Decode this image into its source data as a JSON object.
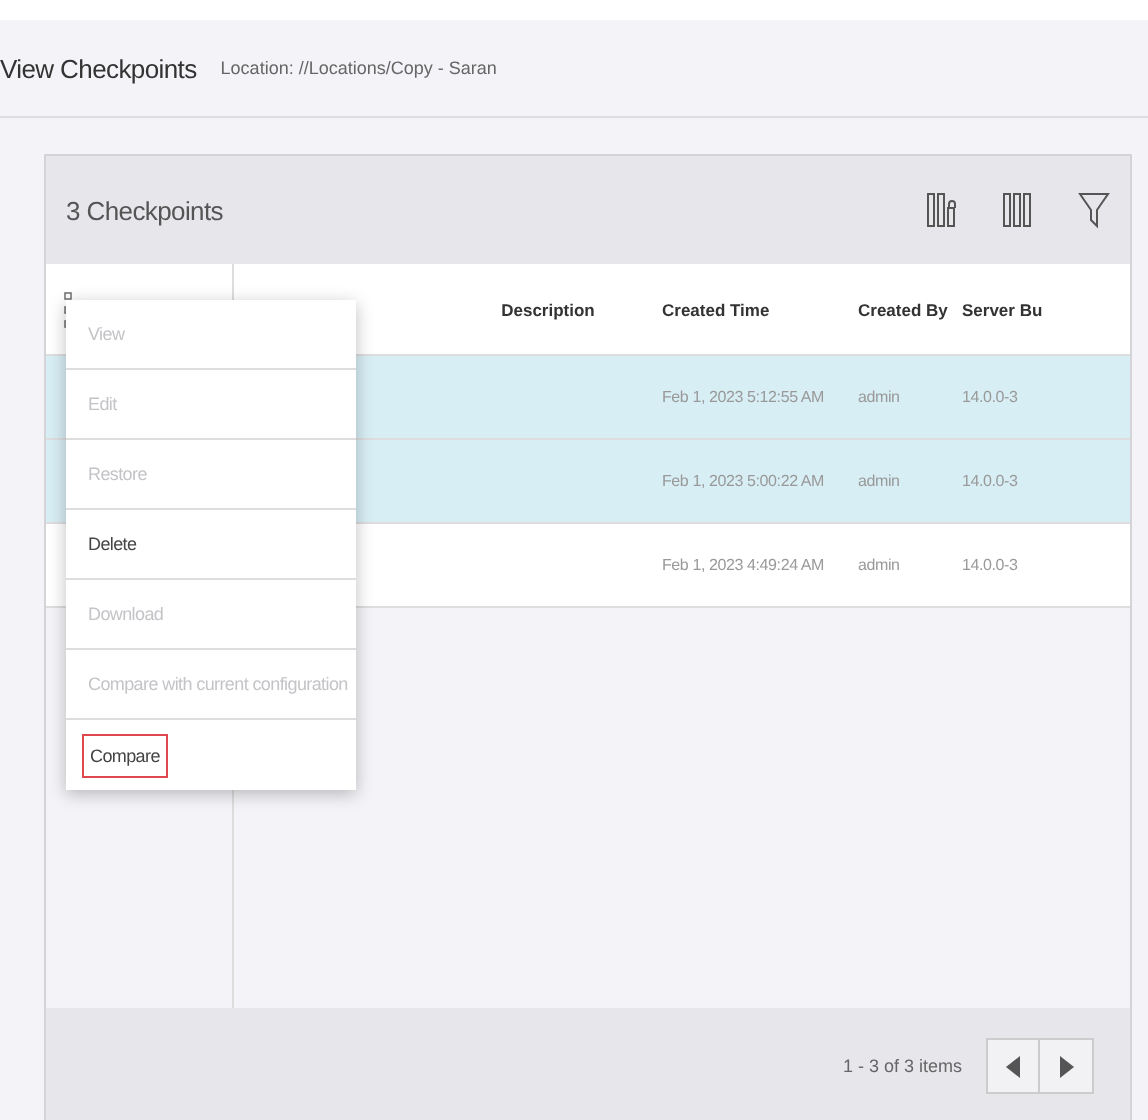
{
  "page": {
    "title": "View Checkpoints",
    "location": "Location: //Locations/Copy - Saran"
  },
  "card": {
    "title": "3 Checkpoints"
  },
  "table": {
    "columns": [
      "Description",
      "Created Time",
      "Created By",
      "Server Bu"
    ],
    "rows": [
      {
        "selected": true,
        "created_time": "Feb 1, 2023 5:12:55 AM",
        "created_by": "admin",
        "server_build": "14.0.0-3"
      },
      {
        "selected": true,
        "created_time": "Feb 1, 2023 5:00:22 AM",
        "created_by": "admin",
        "server_build": "14.0.0-3"
      },
      {
        "selected": false,
        "created_time": "Feb 1, 2023 4:49:24 AM",
        "created_by": "admin",
        "server_build": "14.0.0-3"
      }
    ]
  },
  "context_menu": {
    "items": [
      {
        "label": "View",
        "disabled": true,
        "highlighted": false
      },
      {
        "label": "Edit",
        "disabled": true,
        "highlighted": false
      },
      {
        "label": "Restore",
        "disabled": true,
        "highlighted": false
      },
      {
        "label": "Delete",
        "disabled": false,
        "highlighted": false
      },
      {
        "label": "Download",
        "disabled": true,
        "highlighted": false
      },
      {
        "label": "Compare with current configuration",
        "disabled": true,
        "highlighted": false
      },
      {
        "label": "Compare",
        "disabled": false,
        "highlighted": true
      }
    ]
  },
  "pagination": {
    "summary": "1 - 3 of 3 items"
  }
}
